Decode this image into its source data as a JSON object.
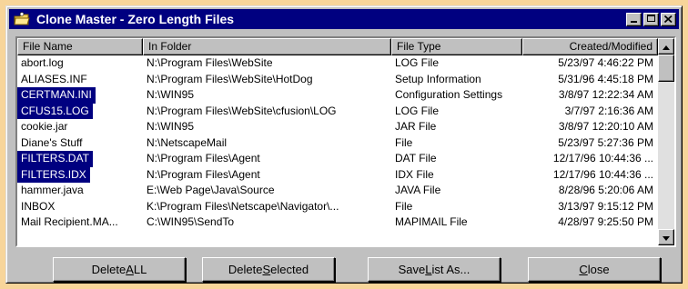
{
  "window": {
    "title": "Clone Master - Zero Length Files"
  },
  "columns": [
    "File Name",
    "In Folder",
    "File Type",
    "Created/Modified"
  ],
  "rows": [
    {
      "name": "abort.log",
      "folder": "N:\\Program Files\\WebSite",
      "type": "LOG File",
      "modified": "5/23/97  4:46:22 PM",
      "selected": false
    },
    {
      "name": "ALIASES.INF",
      "folder": "N:\\Program Files\\WebSite\\HotDog",
      "type": "Setup Information",
      "modified": "5/31/96  4:45:18 PM",
      "selected": false
    },
    {
      "name": "CERTMAN.INI",
      "folder": "N:\\WIN95",
      "type": "Configuration Settings",
      "modified": "3/8/97  12:22:34 AM",
      "selected": true
    },
    {
      "name": "CFUS15.LOG",
      "folder": "N:\\Program Files\\WebSite\\cfusion\\LOG",
      "type": "LOG File",
      "modified": "3/7/97  2:16:36 AM",
      "selected": true
    },
    {
      "name": "cookie.jar",
      "folder": "N:\\WIN95",
      "type": "JAR File",
      "modified": "3/8/97  12:20:10 AM",
      "selected": false
    },
    {
      "name": "Diane's Stuff",
      "folder": "N:\\NetscapeMail",
      "type": "File",
      "modified": "5/23/97  5:27:36 PM",
      "selected": false
    },
    {
      "name": "FILTERS.DAT",
      "folder": "N:\\Program Files\\Agent",
      "type": "DAT File",
      "modified": "12/17/96  10:44:36 ...",
      "selected": true
    },
    {
      "name": "FILTERS.IDX",
      "folder": "N:\\Program Files\\Agent",
      "type": "IDX File",
      "modified": "12/17/96  10:44:36 ...",
      "selected": true
    },
    {
      "name": "hammer.java",
      "folder": "E:\\Web Page\\Java\\Source",
      "type": "JAVA File",
      "modified": "8/28/96  5:20:06 AM",
      "selected": false
    },
    {
      "name": "INBOX",
      "folder": "K:\\Program Files\\Netscape\\Navigator\\...",
      "type": "File",
      "modified": "3/13/97  9:15:12 PM",
      "selected": false
    },
    {
      "name": "Mail Recipient.MA...",
      "folder": "C:\\WIN95\\SendTo",
      "type": "MAPIMAIL File",
      "modified": "4/28/97  9:25:50 PM",
      "selected": false
    }
  ],
  "buttons": {
    "delete_all": {
      "pre": "Delete ",
      "accel": "A",
      "post": "LL"
    },
    "delete_selected": {
      "pre": "Delete ",
      "accel": "S",
      "post": "elected"
    },
    "save_list": {
      "pre": "Save ",
      "accel": "L",
      "post": "ist As..."
    },
    "close": {
      "pre": "",
      "accel": "C",
      "post": "lose"
    }
  }
}
